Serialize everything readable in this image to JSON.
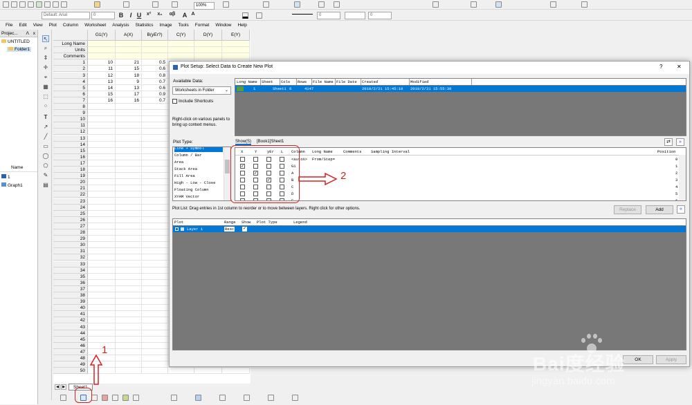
{
  "toolbar": {
    "font_name": "Default: Arial",
    "font_size": "0",
    "zoom": "100%",
    "bold": "B",
    "italic": "I",
    "underline": "U",
    "superscript": "x²",
    "subscript": "x₂",
    "greek": "αβ",
    "big_a": "A",
    "small_a": "A",
    "line_width": "0",
    "fill_value": "0"
  },
  "menu": [
    "File",
    "Edit",
    "View",
    "Plot",
    "Column",
    "Worksheet",
    "Analysis",
    "Statistics",
    "Image",
    "Tools",
    "Format",
    "Window",
    "Help"
  ],
  "project": {
    "panel_title": "Projec...",
    "root": "UNTITLED",
    "folder": "Folder1",
    "list_header": "Name",
    "items": [
      "1",
      "Graph1"
    ]
  },
  "sheet": {
    "columns": [
      "G1(Y)",
      "A(X)",
      "B(yEr?)",
      "C(Y)",
      "D(Y)",
      "E(Y)"
    ],
    "label_rows": [
      "Long Name",
      "Units",
      "Comments"
    ],
    "rows": [
      [
        "10",
        "21",
        "0.5"
      ],
      [
        "11",
        "15",
        "0.6"
      ],
      [
        "12",
        "18",
        "0.8"
      ],
      [
        "13",
        "9",
        "0.7"
      ],
      [
        "14",
        "13",
        "0.6"
      ],
      [
        "15",
        "17",
        "0.9"
      ],
      [
        "16",
        "16",
        "0.7"
      ]
    ],
    "row_count": 50,
    "tab_name": "Sheet1"
  },
  "dialog": {
    "title": "Plot Setup: Select Data to Create New Plot",
    "help": "?",
    "close": "✕",
    "available_label": "Available Data:",
    "available_value": "Worksheets in Folder",
    "include_shortcuts": "Include Shortcuts",
    "hint": "Right-click on various panels to bring up context menus.",
    "data_columns": [
      "Long Name",
      "Sheet",
      "Cols",
      "Rows",
      "File Name",
      "File Date",
      "Created",
      "Modified"
    ],
    "data_row": [
      "1",
      "Sheet1",
      "6",
      "4147",
      "",
      "",
      "2019/2/21 15:45:10",
      "2019/2/21 15:55:30"
    ],
    "plot_type_label": "Plot Type:",
    "plot_types": [
      "Line + Symbol",
      "Column / Bar",
      "Area",
      "Stack Area",
      "Fill Area",
      "High - Low - Close",
      "Floating Column",
      "XYAM Vector"
    ],
    "show_tab": "Show(S)",
    "book_tab": "[Book1]Sheet1",
    "assign_headers": [
      "X",
      "Y",
      "yEr",
      "L",
      "Column",
      "Long Name",
      "Comments",
      "Sampling Interval",
      "Position"
    ],
    "assign_rows": [
      {
        "col": "<autoX>",
        "long": "From/Step=",
        "pos": "0",
        "x": false,
        "y": false,
        "yer": false,
        "l": false
      },
      {
        "col": "G1",
        "long": "",
        "pos": "1",
        "x": true,
        "y": false,
        "yer": false,
        "l": false
      },
      {
        "col": "A",
        "long": "",
        "pos": "2",
        "x": false,
        "y": true,
        "yer": false,
        "l": false
      },
      {
        "col": "B",
        "long": "",
        "pos": "3",
        "x": false,
        "y": false,
        "yer": true,
        "l": false
      },
      {
        "col": "C",
        "long": "",
        "pos": "4",
        "x": false,
        "y": false,
        "yer": false,
        "l": false
      },
      {
        "col": "D",
        "long": "",
        "pos": "5",
        "x": false,
        "y": false,
        "yer": false,
        "l": false
      },
      {
        "col": "E",
        "long": "",
        "pos": "6",
        "x": false,
        "y": false,
        "yer": false,
        "l": false
      }
    ],
    "plot_list_hint": "Plot List: Drag entries in 1st column to reorder or to move between layers. Right click for other options.",
    "replace": "Replace",
    "add": "Add",
    "list_headers": [
      "Plot",
      "Range",
      "Show",
      "Plot Type",
      "Legend"
    ],
    "layer_row": "Layer 1",
    "layer_range": "Resc",
    "ok": "OK",
    "apply": "Apply"
  },
  "annotations": {
    "arrow_label_right": "2",
    "arrow_label_bottom": "1",
    "accent": "#d62020",
    "select_blue": "#0078d7"
  },
  "watermark": {
    "brand": "Bai度经验",
    "url": "jingyan.baidu.com"
  }
}
